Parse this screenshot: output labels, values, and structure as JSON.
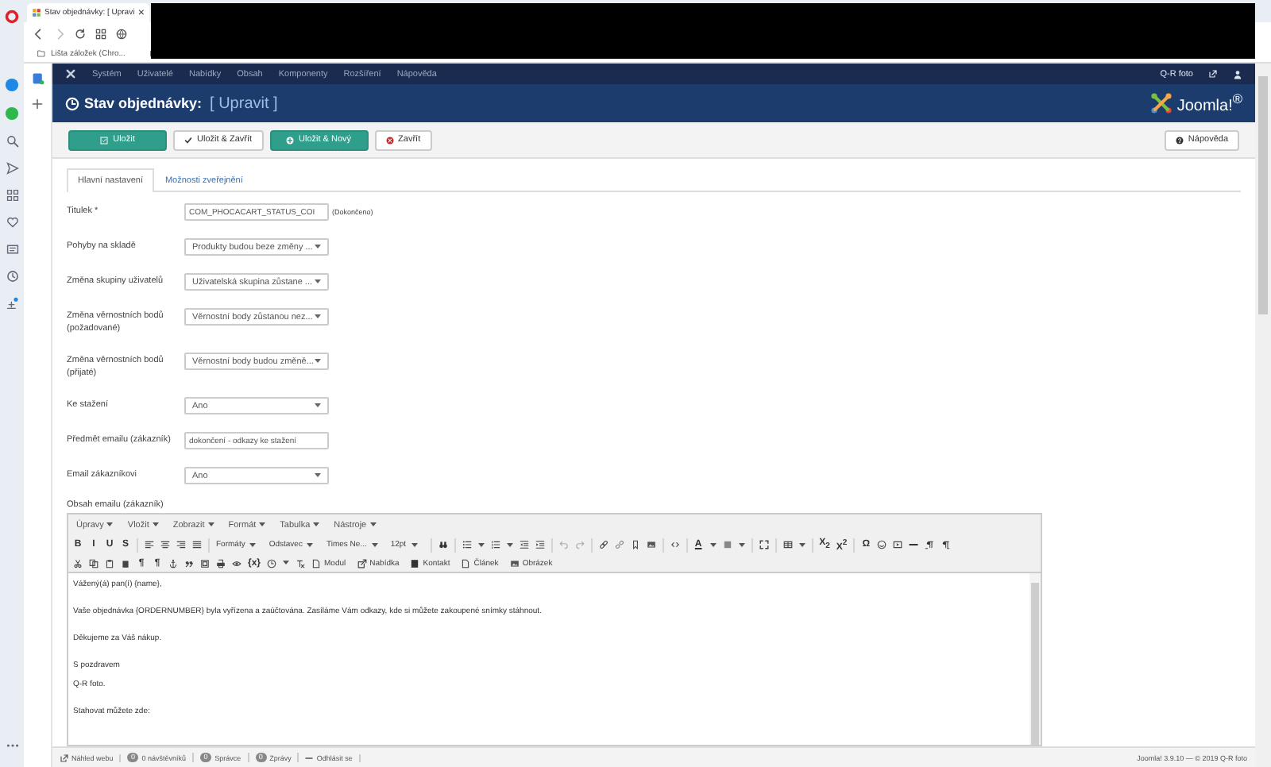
{
  "browser": {
    "tab": {
      "title": "Stav objednávky: [ Upravi",
      "close": "×"
    },
    "bookmarks": [
      {
        "label": "Lišta záložek (Chro..."
      }
    ]
  },
  "admin_menu": {
    "items": [
      "Systém",
      "Uživatelé",
      "Nabídky",
      "Obsah",
      "Komponenty",
      "Rozšíření",
      "Nápověda"
    ],
    "site_link": "Q-R foto"
  },
  "header": {
    "title": "Stav objednávky:",
    "subtitle": "[ Upravit ]",
    "logo": "Joomla!$^{®}$"
  },
  "toolbar": {
    "buttons": [
      {
        "label": "Uložit",
        "kind": "save"
      },
      {
        "label": "Uložit & Zavřít",
        "kind": "saveclose"
      },
      {
        "label": "Uložit & Nový",
        "kind": "savenew"
      },
      {
        "label": "Zavřít",
        "kind": "close"
      }
    ],
    "help": "Nápověda"
  },
  "tabs": [
    {
      "label": "Hlavní nastavení",
      "selected": true
    },
    {
      "label": "Možnosti zveřejnění",
      "selected": false
    }
  ],
  "fields": [
    {
      "label": "Titulek *",
      "kind": "text",
      "value": "COM_PHOCACART_STATUS_COI",
      "note": "(Dokončeno)"
    },
    {
      "label": "Pohyby na skladě",
      "kind": "select",
      "value": "Produkty budou beze změny ..."
    },
    {
      "label": "Změna skupiny uživatelů",
      "kind": "select",
      "value": "Uživatelská skupina zůstane ..."
    },
    {
      "label": "Změna věrnostních bodů (požadované)",
      "kind": "select",
      "value": "Věrnostní body zůstanou nez..."
    },
    {
      "label": "Změna věrnostních bodů (přijaté)",
      "kind": "select",
      "value": "Věrnostní body budou změně..."
    },
    {
      "label": "Ke stažení",
      "kind": "select",
      "value": "Ano"
    },
    {
      "label": "Předmět emailu (zákazník)",
      "kind": "text",
      "value": "dokončení - odkazy ke stažení"
    },
    {
      "label": "Email zákazníkovi",
      "kind": "select",
      "value": "Ano"
    }
  ],
  "editor": {
    "label": "Obsah emailu (zákazník)",
    "menu": [
      "Úpravy",
      "Vložit",
      "Zobrazit",
      "Formát",
      "Tabulka",
      "Nástroje"
    ],
    "toolbar_rows": [
      [
        {
          "kind": "glyph",
          "label": "B"
        },
        {
          "kind": "glyph",
          "label": "I"
        },
        {
          "kind": "glyph",
          "label": "U"
        },
        {
          "kind": "glyph",
          "label": "S"
        },
        {
          "kind": "sep"
        },
        {
          "kind": "icon"
        },
        {
          "kind": "icon"
        },
        {
          "kind": "icon"
        },
        {
          "kind": "icon"
        },
        {
          "kind": "sep"
        },
        {
          "kind": "dropdown",
          "label": "Formáty"
        },
        {
          "kind": "dropdown",
          "label": "Odstavec"
        },
        {
          "kind": "dropdown",
          "label": "Times Ne..."
        },
        {
          "kind": "dropdown",
          "label": "12pt"
        },
        {
          "kind": "sep"
        },
        {
          "kind": "icon"
        },
        {
          "kind": "sep"
        },
        {
          "kind": "icon"
        },
        {
          "kind": "icon"
        },
        {
          "kind": "icon"
        },
        {
          "kind": "icon"
        },
        {
          "kind": "sep"
        },
        {
          "kind": "icon"
        },
        {
          "kind": "icon"
        },
        {
          "kind": "sep"
        },
        {
          "kind": "icon"
        },
        {
          "kind": "icon"
        },
        {
          "kind": "icon"
        },
        {
          "kind": "icon"
        },
        {
          "kind": "sep"
        },
        {
          "kind": "icon"
        },
        {
          "kind": "sep"
        },
        {
          "kind": "underlined",
          "label": "A"
        },
        {
          "kind": "icon"
        },
        {
          "kind": "sep"
        },
        {
          "kind": "icon"
        },
        {
          "kind": "sep"
        },
        {
          "kind": "icon"
        },
        {
          "kind": "sep"
        },
        {
          "kind": "glyph",
          "label": "X$_{2}$"
        },
        {
          "kind": "glyph",
          "label": "X$^{2}$"
        },
        {
          "kind": "sep"
        },
        {
          "kind": "glyph",
          "label": "Ω"
        },
        {
          "kind": "icon"
        },
        {
          "kind": "icon"
        },
        {
          "kind": "icon"
        },
        {
          "kind": "icon"
        },
        {
          "kind": "icon"
        }
      ],
      [
        {
          "kind": "icon"
        },
        {
          "kind": "icon"
        },
        {
          "kind": "icon"
        },
        {
          "kind": "icon"
        },
        {
          "kind": "glyph",
          "label": "¶"
        },
        {
          "kind": "glyph",
          "label": "¶"
        },
        {
          "kind": "icon"
        },
        {
          "kind": "icon"
        },
        {
          "kind": "icon"
        },
        {
          "kind": "icon"
        },
        {
          "kind": "icon"
        },
        {
          "kind": "glyph",
          "label": "{x}"
        },
        {
          "kind": "icon"
        },
        {
          "kind": "icon"
        },
        {
          "kind": "button",
          "label": "Modul"
        },
        {
          "kind": "button",
          "label": "Nabídka"
        },
        {
          "kind": "button",
          "label": "Kontakt"
        },
        {
          "kind": "button",
          "label": "Článek"
        },
        {
          "kind": "button",
          "label": "Obrázek"
        }
      ]
    ],
    "content": [
      [
        "Vážený(á) pan(í) {name},"
      ],
      [
        "Vaše objednávka {ORDERNUMBER} byla vyřízena a zaúčtována. Zasíláme Vám odkazy, kde si můžete zakoupené snímky stáhnout."
      ],
      [
        "Děkujeme za Váš nákup."
      ],
      [
        "S pozdravem",
        "Q-R foto."
      ],
      [
        "Stahovat můžete zde:"
      ]
    ]
  },
  "status_bar": {
    "items": [
      {
        "kind": "link",
        "label": "Náhled webu"
      },
      {
        "kind": "count",
        "count": "0",
        "label": "0 návštěvníků"
      },
      {
        "kind": "count",
        "count": "0",
        "label": "Správce"
      },
      {
        "kind": "count",
        "count": "0",
        "label": "Zprávy"
      },
      {
        "kind": "logout",
        "label": "Odhlásit se"
      }
    ],
    "version": "Joomla! 3.9.10 — © 2019 Q-R foto"
  }
}
